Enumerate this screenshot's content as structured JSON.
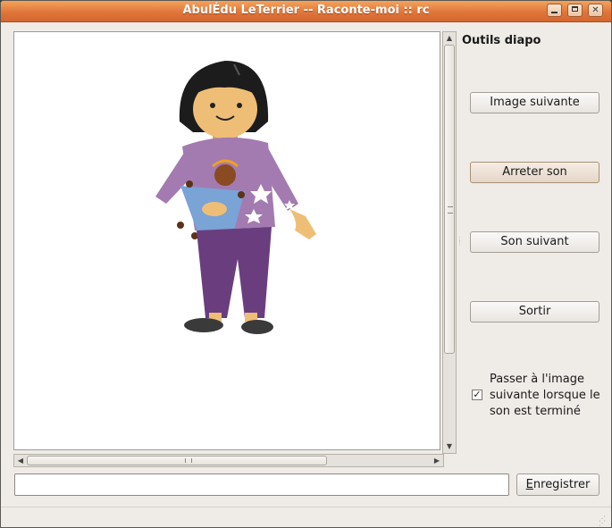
{
  "window": {
    "title": "AbulÉdu LeTerrier -- Raconte-moi :: rc",
    "controls": [
      "minimize-icon",
      "maximize-icon",
      "close-icon"
    ]
  },
  "panel": {
    "title": "Outils diapo",
    "buttons": {
      "next_image": "Image suivante",
      "stop_sound": "Arreter son",
      "next_sound": "Son suivant",
      "quit": "Sortir"
    },
    "checkbox": {
      "checked": true,
      "label": "Passer à l'image suivante lorsque le son est terminé"
    }
  },
  "footer": {
    "input_value": "",
    "save_button": "Enregistrer",
    "save_mnemonic": "E"
  },
  "image": {
    "subject": "girl-holding-doll-illustration"
  },
  "colors": {
    "titlebar": "#e0763a",
    "sweater": "#a37bb0",
    "pants": "#6a3d7f",
    "skin": "#efbe76",
    "doll_dress": "#7aa3d6"
  }
}
